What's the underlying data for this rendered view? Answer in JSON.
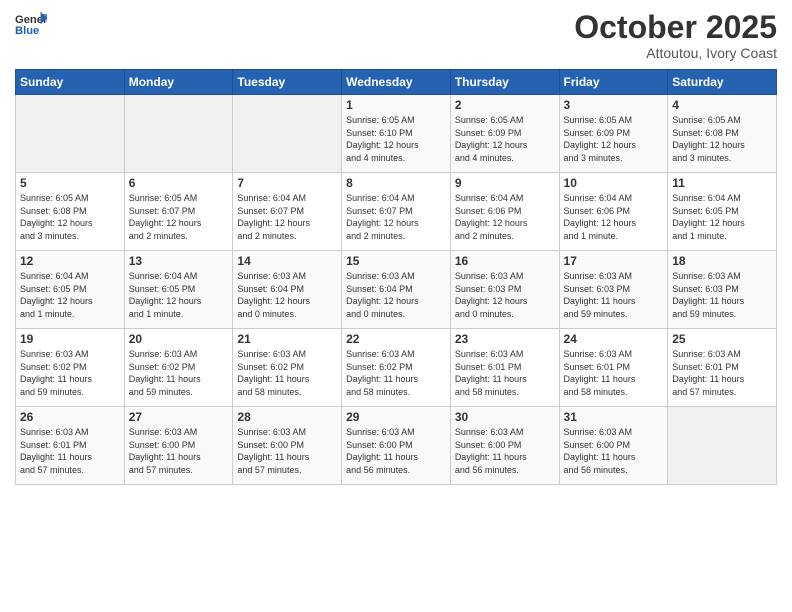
{
  "header": {
    "logo_general": "General",
    "logo_blue": "Blue",
    "month": "October 2025",
    "location": "Attoutou, Ivory Coast"
  },
  "weekdays": [
    "Sunday",
    "Monday",
    "Tuesday",
    "Wednesday",
    "Thursday",
    "Friday",
    "Saturday"
  ],
  "weeks": [
    [
      {
        "day": "",
        "info": ""
      },
      {
        "day": "",
        "info": ""
      },
      {
        "day": "",
        "info": ""
      },
      {
        "day": "1",
        "info": "Sunrise: 6:05 AM\nSunset: 6:10 PM\nDaylight: 12 hours\nand 4 minutes."
      },
      {
        "day": "2",
        "info": "Sunrise: 6:05 AM\nSunset: 6:09 PM\nDaylight: 12 hours\nand 4 minutes."
      },
      {
        "day": "3",
        "info": "Sunrise: 6:05 AM\nSunset: 6:09 PM\nDaylight: 12 hours\nand 3 minutes."
      },
      {
        "day": "4",
        "info": "Sunrise: 6:05 AM\nSunset: 6:08 PM\nDaylight: 12 hours\nand 3 minutes."
      }
    ],
    [
      {
        "day": "5",
        "info": "Sunrise: 6:05 AM\nSunset: 6:08 PM\nDaylight: 12 hours\nand 3 minutes."
      },
      {
        "day": "6",
        "info": "Sunrise: 6:05 AM\nSunset: 6:07 PM\nDaylight: 12 hours\nand 2 minutes."
      },
      {
        "day": "7",
        "info": "Sunrise: 6:04 AM\nSunset: 6:07 PM\nDaylight: 12 hours\nand 2 minutes."
      },
      {
        "day": "8",
        "info": "Sunrise: 6:04 AM\nSunset: 6:07 PM\nDaylight: 12 hours\nand 2 minutes."
      },
      {
        "day": "9",
        "info": "Sunrise: 6:04 AM\nSunset: 6:06 PM\nDaylight: 12 hours\nand 2 minutes."
      },
      {
        "day": "10",
        "info": "Sunrise: 6:04 AM\nSunset: 6:06 PM\nDaylight: 12 hours\nand 1 minute."
      },
      {
        "day": "11",
        "info": "Sunrise: 6:04 AM\nSunset: 6:05 PM\nDaylight: 12 hours\nand 1 minute."
      }
    ],
    [
      {
        "day": "12",
        "info": "Sunrise: 6:04 AM\nSunset: 6:05 PM\nDaylight: 12 hours\nand 1 minute."
      },
      {
        "day": "13",
        "info": "Sunrise: 6:04 AM\nSunset: 6:05 PM\nDaylight: 12 hours\nand 1 minute."
      },
      {
        "day": "14",
        "info": "Sunrise: 6:03 AM\nSunset: 6:04 PM\nDaylight: 12 hours\nand 0 minutes."
      },
      {
        "day": "15",
        "info": "Sunrise: 6:03 AM\nSunset: 6:04 PM\nDaylight: 12 hours\nand 0 minutes."
      },
      {
        "day": "16",
        "info": "Sunrise: 6:03 AM\nSunset: 6:03 PM\nDaylight: 12 hours\nand 0 minutes."
      },
      {
        "day": "17",
        "info": "Sunrise: 6:03 AM\nSunset: 6:03 PM\nDaylight: 11 hours\nand 59 minutes."
      },
      {
        "day": "18",
        "info": "Sunrise: 6:03 AM\nSunset: 6:03 PM\nDaylight: 11 hours\nand 59 minutes."
      }
    ],
    [
      {
        "day": "19",
        "info": "Sunrise: 6:03 AM\nSunset: 6:02 PM\nDaylight: 11 hours\nand 59 minutes."
      },
      {
        "day": "20",
        "info": "Sunrise: 6:03 AM\nSunset: 6:02 PM\nDaylight: 11 hours\nand 59 minutes."
      },
      {
        "day": "21",
        "info": "Sunrise: 6:03 AM\nSunset: 6:02 PM\nDaylight: 11 hours\nand 58 minutes."
      },
      {
        "day": "22",
        "info": "Sunrise: 6:03 AM\nSunset: 6:02 PM\nDaylight: 11 hours\nand 58 minutes."
      },
      {
        "day": "23",
        "info": "Sunrise: 6:03 AM\nSunset: 6:01 PM\nDaylight: 11 hours\nand 58 minutes."
      },
      {
        "day": "24",
        "info": "Sunrise: 6:03 AM\nSunset: 6:01 PM\nDaylight: 11 hours\nand 58 minutes."
      },
      {
        "day": "25",
        "info": "Sunrise: 6:03 AM\nSunset: 6:01 PM\nDaylight: 11 hours\nand 57 minutes."
      }
    ],
    [
      {
        "day": "26",
        "info": "Sunrise: 6:03 AM\nSunset: 6:01 PM\nDaylight: 11 hours\nand 57 minutes."
      },
      {
        "day": "27",
        "info": "Sunrise: 6:03 AM\nSunset: 6:00 PM\nDaylight: 11 hours\nand 57 minutes."
      },
      {
        "day": "28",
        "info": "Sunrise: 6:03 AM\nSunset: 6:00 PM\nDaylight: 11 hours\nand 57 minutes."
      },
      {
        "day": "29",
        "info": "Sunrise: 6:03 AM\nSunset: 6:00 PM\nDaylight: 11 hours\nand 56 minutes."
      },
      {
        "day": "30",
        "info": "Sunrise: 6:03 AM\nSunset: 6:00 PM\nDaylight: 11 hours\nand 56 minutes."
      },
      {
        "day": "31",
        "info": "Sunrise: 6:03 AM\nSunset: 6:00 PM\nDaylight: 11 hours\nand 56 minutes."
      },
      {
        "day": "",
        "info": ""
      }
    ]
  ]
}
